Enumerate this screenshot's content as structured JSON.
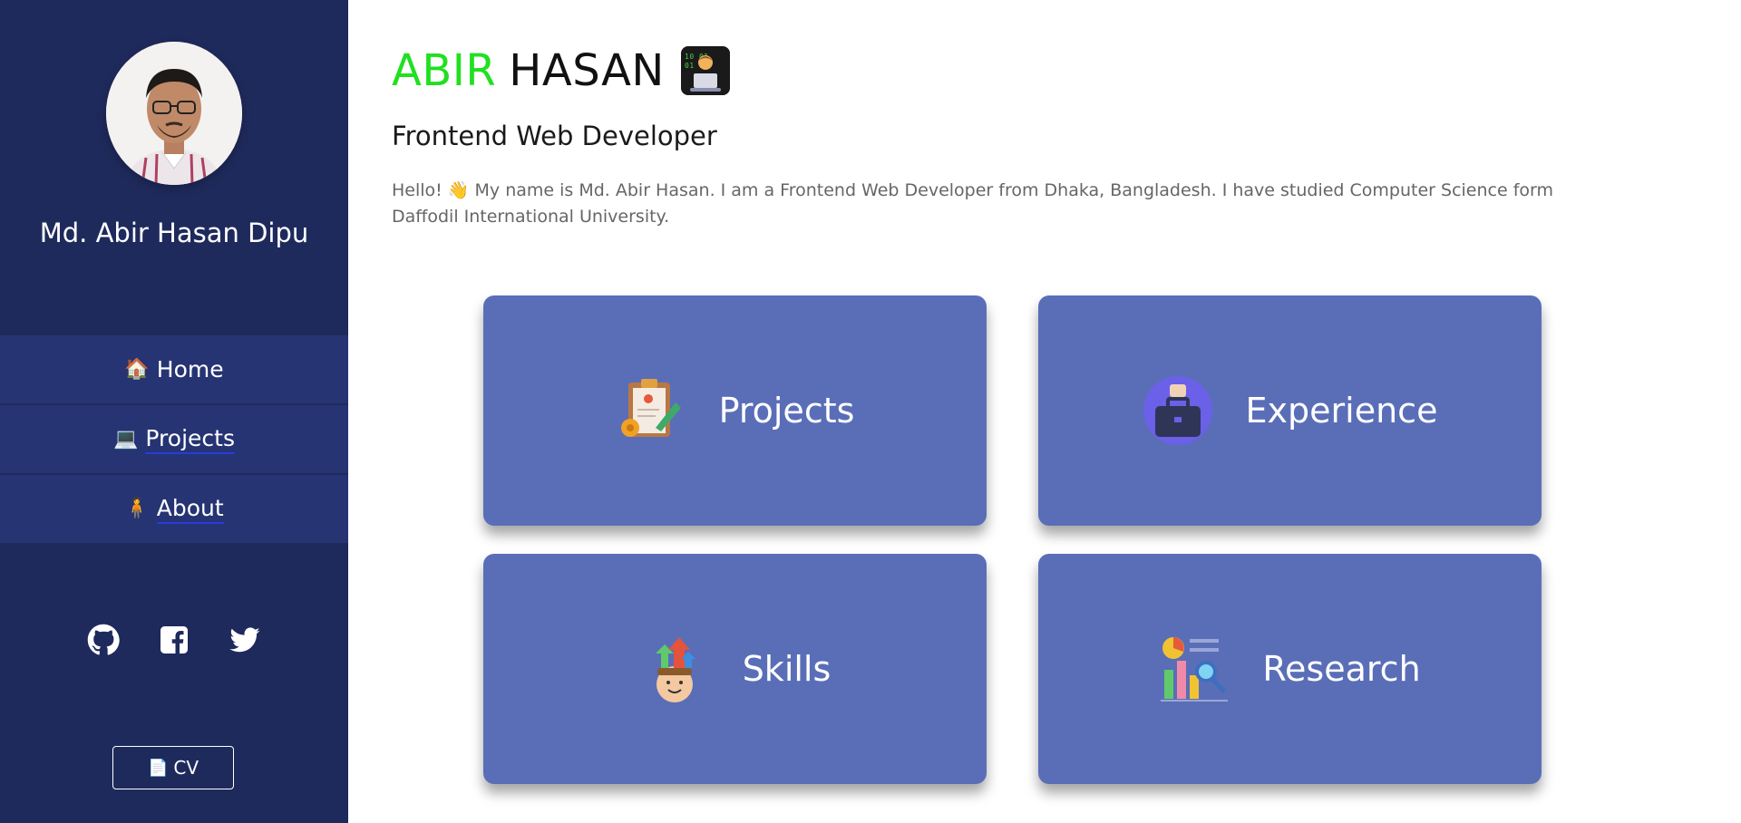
{
  "profile": {
    "name": "Md. Abir Hasan Dipu"
  },
  "nav": {
    "items": [
      {
        "emoji": "🏠",
        "label": "Home"
      },
      {
        "emoji": "💻",
        "label": "Projects"
      },
      {
        "emoji": "🧍",
        "label": "About"
      }
    ]
  },
  "socials": [
    "github-icon",
    "facebook-icon",
    "twitter-icon"
  ],
  "cv": {
    "emoji": "📄",
    "label": "CV"
  },
  "header": {
    "first_name": "ABIR",
    "last_name": "HASAN",
    "subtitle": "Frontend Web Developer",
    "bio": "Hello! 👋 My name is Md. Abir Hasan. I am a Frontend Web Developer from Dhaka, Bangladesh. I have studied Computer Science form Daffodil International University."
  },
  "cards": {
    "projects": "Projects",
    "experience": "Experience",
    "skills": "Skills",
    "research": "Research"
  },
  "colors": {
    "sidebar": "#1f2a5c",
    "nav_item": "#263473",
    "card": "#5a6eb8",
    "accent_green": "#20e020"
  }
}
